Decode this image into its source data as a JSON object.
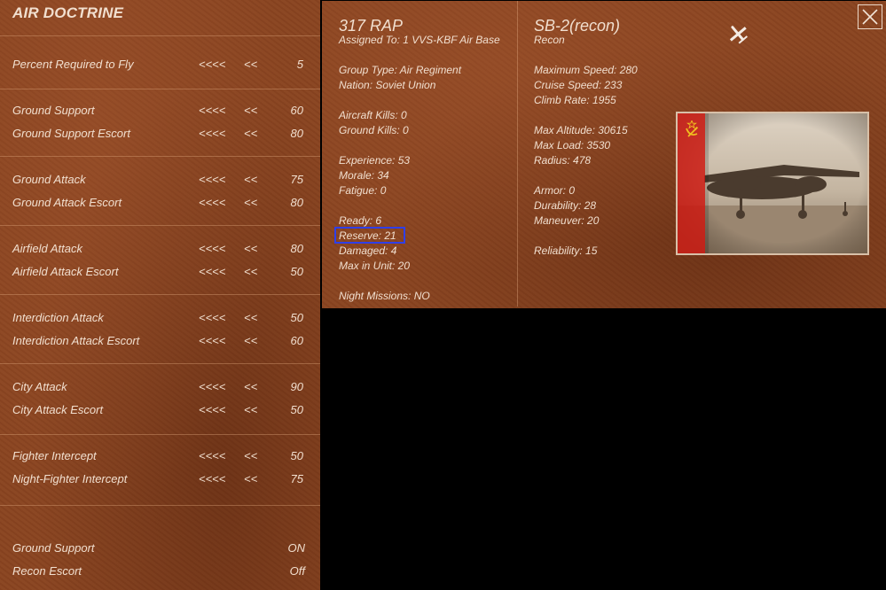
{
  "doctrine": {
    "title": "AIR DOCTRINE",
    "rows": [
      {
        "label": "Percent Required to Fly",
        "dec_big": "<<<<",
        "dec_small": "<<",
        "value": "5"
      },
      {
        "label": "Ground Support",
        "dec_big": "<<<<",
        "dec_small": "<<",
        "value": "60"
      },
      {
        "label": "Ground Support Escort",
        "dec_big": "<<<<",
        "dec_small": "<<",
        "value": "80"
      },
      {
        "label": "Ground Attack",
        "dec_big": "<<<<",
        "dec_small": "<<",
        "value": "75"
      },
      {
        "label": "Ground Attack Escort",
        "dec_big": "<<<<",
        "dec_small": "<<",
        "value": "80"
      },
      {
        "label": "Airfield Attack",
        "dec_big": "<<<<",
        "dec_small": "<<",
        "value": "80"
      },
      {
        "label": "Airfield Attack Escort",
        "dec_big": "<<<<",
        "dec_small": "<<",
        "value": "50"
      },
      {
        "label": "Interdiction Attack",
        "dec_big": "<<<<",
        "dec_small": "<<",
        "value": "50"
      },
      {
        "label": "Interdiction Attack Escort",
        "dec_big": "<<<<",
        "dec_small": "<<",
        "value": "60"
      },
      {
        "label": "City Attack",
        "dec_big": "<<<<",
        "dec_small": "<<",
        "value": "90"
      },
      {
        "label": "City Attack Escort",
        "dec_big": "<<<<",
        "dec_small": "<<",
        "value": "50"
      },
      {
        "label": "Fighter Intercept",
        "dec_big": "<<<<",
        "dec_small": "<<",
        "value": "50"
      },
      {
        "label": "Night-Fighter Intercept",
        "dec_big": "<<<<",
        "dec_small": "<<",
        "value": "75"
      }
    ],
    "toggles": [
      {
        "label": "Ground Support",
        "value": "ON"
      },
      {
        "label": "Recon Escort",
        "value": "Off"
      }
    ]
  },
  "unit": {
    "name": "317 RAP",
    "assigned": "Assigned To: 1 VVS-KBF Air Base",
    "group_type": "Group Type: Air Regiment",
    "nation": "Nation: Soviet Union",
    "aircraft_kills": "Aircraft Kills: 0",
    "ground_kills": "Ground Kills: 0",
    "experience": "Experience: 53",
    "morale": "Morale: 34",
    "fatigue": "Fatigue: 0",
    "ready": "Ready: 6",
    "reserve": "Reserve: 21",
    "damaged": "Damaged: 4",
    "max_in_unit": "Max in Unit:  20",
    "night_missions": "Night Missions: NO"
  },
  "aircraft": {
    "name": "SB-2(recon)",
    "role": "Recon",
    "max_speed": "Maximum Speed: 280",
    "cruise_speed": "Cruise Speed: 233",
    "climb_rate": "Climb Rate: 1955",
    "max_altitude": "Max Altitude: 30615",
    "max_load": "Max Load: 3530",
    "radius": "Radius: 478",
    "armor": "Armor: 0",
    "durability": "Durability: 28",
    "maneuver": "Maneuver: 20",
    "reliability": "Reliability: 15"
  },
  "icons": {
    "close": "close-icon",
    "plane": "plane-icon",
    "flag": "soviet-flag-icon"
  },
  "colors": {
    "panel": "#8a4420",
    "text": "#f1dfcf",
    "highlight_box": "#2f3fe8",
    "background": "#000000",
    "flag_red": "#cc1a12",
    "flag_gold": "#f0c020"
  }
}
